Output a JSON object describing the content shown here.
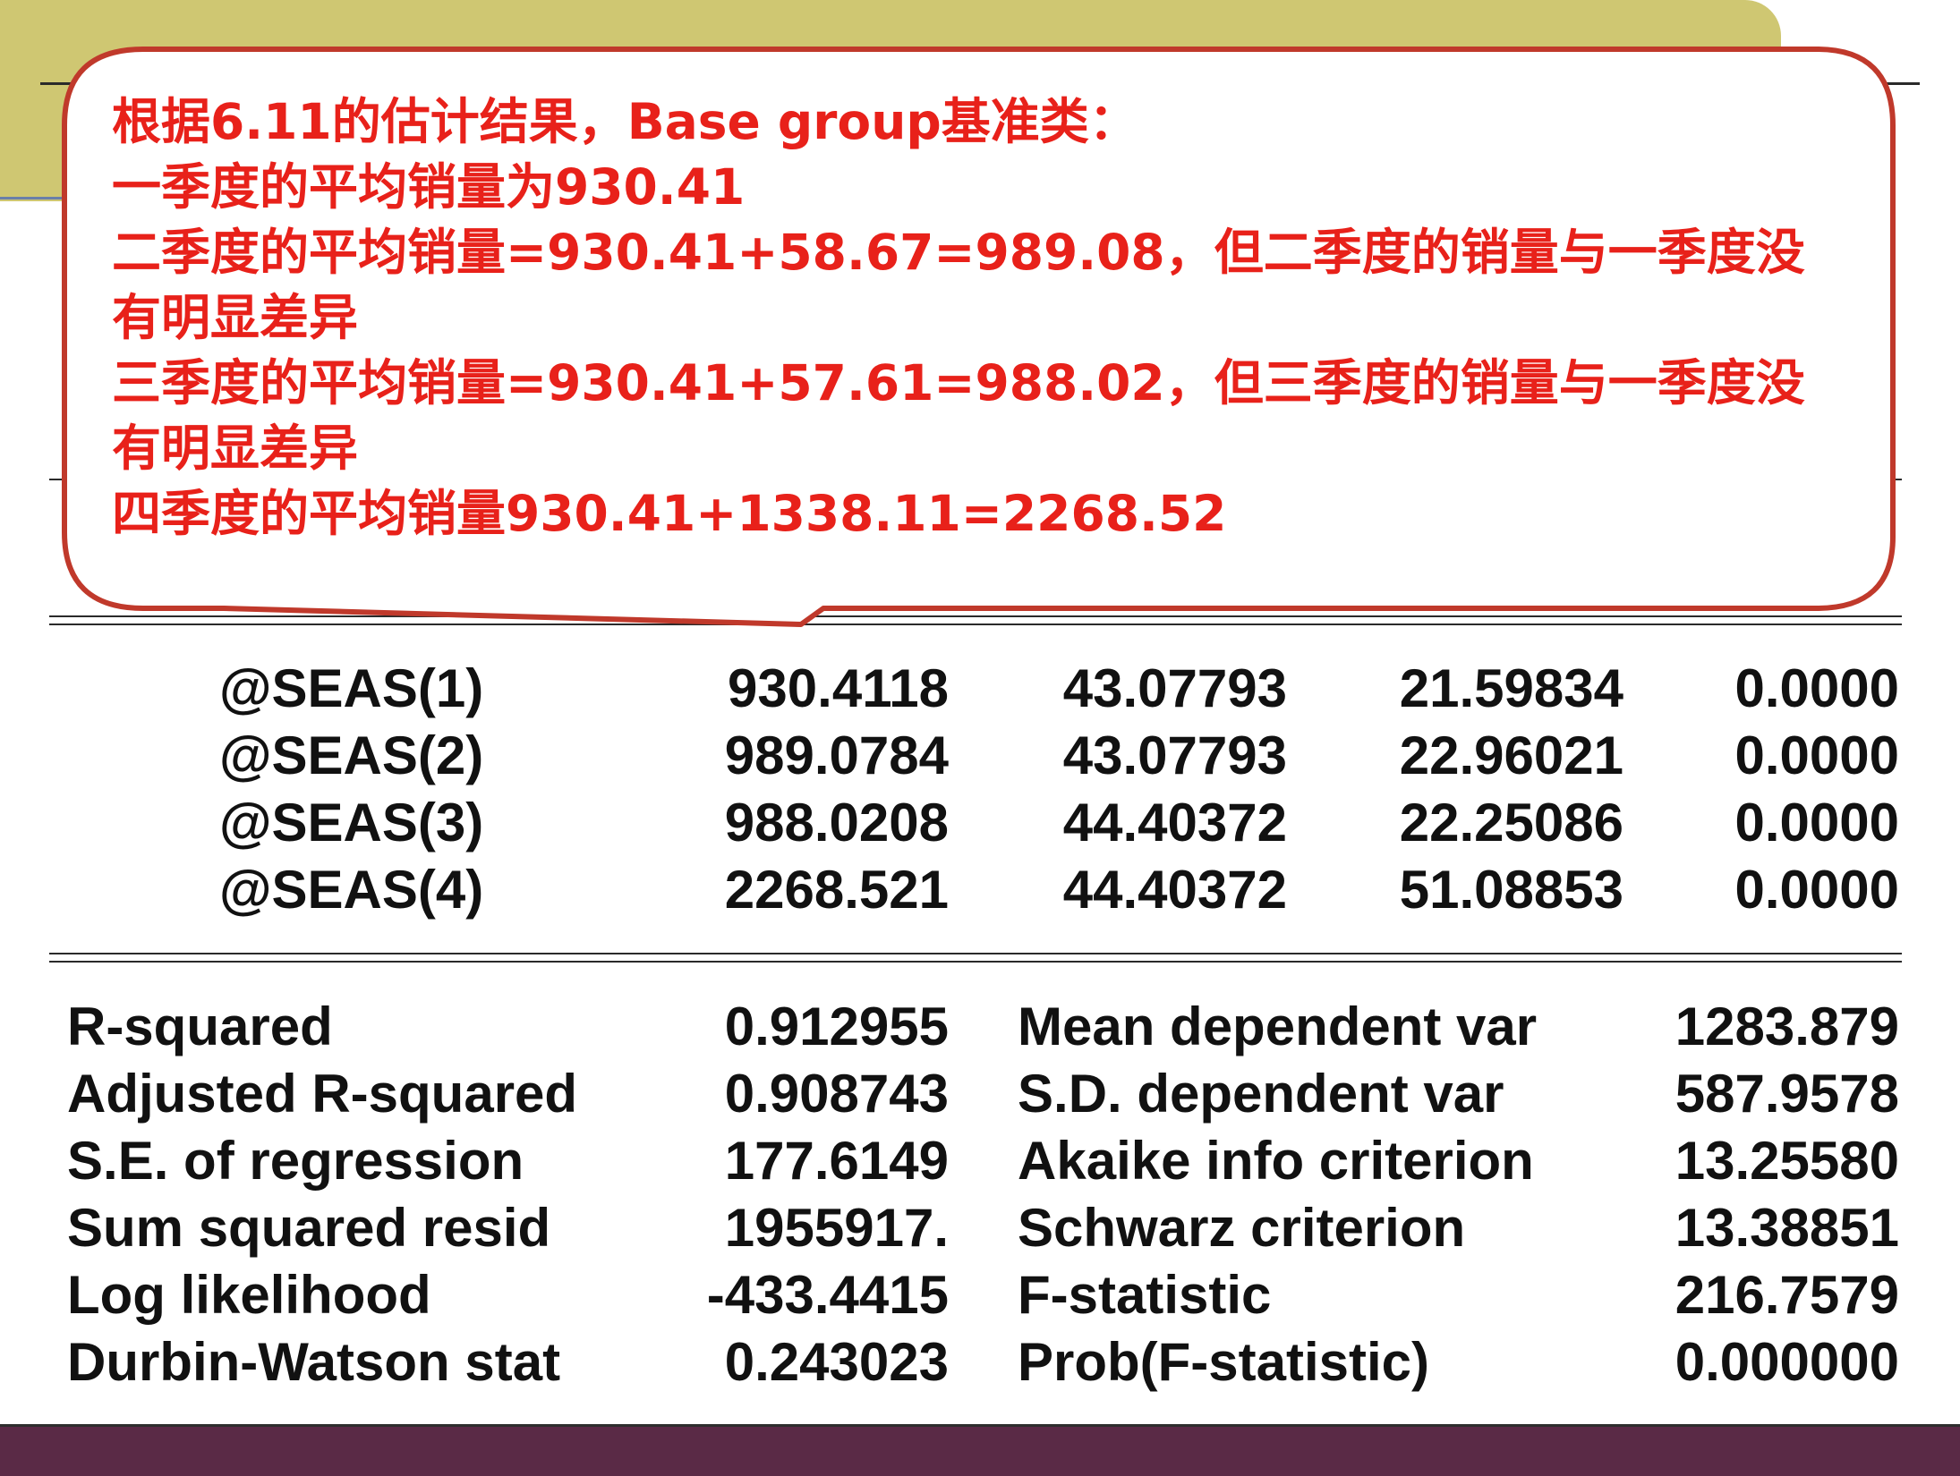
{
  "callout": {
    "lines": [
      "根据6.11的估计结果，Base group基准类：",
      "一季度的平均销量为930.41",
      "二季度的平均销量=930.41+58.67=989.08，但二季度的销量与一季度没",
      "有明显差异",
      "三季度的平均销量=930.41+57.61=988.02，但三季度的销量与一季度没",
      "有明显差异",
      "四季度的平均销量930.41+1338.11=2268.52"
    ],
    "text_color": "#e8211a",
    "border_color": "#c0392b"
  },
  "coefficients": [
    {
      "variable": "@SEAS(1)",
      "coefficient": "930.4118",
      "std_error": "43.07793",
      "t_statistic": "21.59834",
      "prob": "0.0000"
    },
    {
      "variable": "@SEAS(2)",
      "coefficient": "989.0784",
      "std_error": "43.07793",
      "t_statistic": "22.96021",
      "prob": "0.0000"
    },
    {
      "variable": "@SEAS(3)",
      "coefficient": "988.0208",
      "std_error": "44.40372",
      "t_statistic": "22.25086",
      "prob": "0.0000"
    },
    {
      "variable": "@SEAS(4)",
      "coefficient": "2268.521",
      "std_error": "44.40372",
      "t_statistic": "51.08853",
      "prob": "0.0000"
    }
  ],
  "statistics": [
    {
      "label": "R-squared",
      "value": "0.912955",
      "label2": "Mean dependent var",
      "value2": "1283.879"
    },
    {
      "label": "Adjusted R-squared",
      "value": "0.908743",
      "label2": "S.D. dependent var",
      "value2": "587.9578"
    },
    {
      "label": "S.E. of regression",
      "value": "177.6149",
      "label2": "Akaike info criterion",
      "value2": "13.25580"
    },
    {
      "label": "Sum squared resid",
      "value": "1955917.",
      "label2": "Schwarz criterion",
      "value2": "13.38851"
    },
    {
      "label": "Log likelihood",
      "value": "-433.4415",
      "label2": "F-statistic",
      "value2": "216.7579"
    },
    {
      "label": "Durbin-Watson stat",
      "value": "0.243023",
      "label2": "Prob(F-statistic)",
      "value2": "0.000000"
    }
  ],
  "colors": {
    "olive_bar": "#cfc772",
    "bottom_bar": "#5a2a46",
    "table_text": "#111111"
  }
}
